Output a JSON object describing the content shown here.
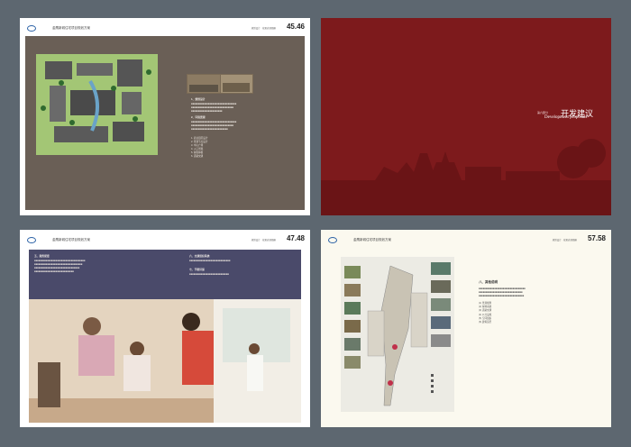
{
  "pages": [
    {
      "header": "金鹰新城住宅项目规划方案",
      "subheader": "规划设计 · 效果表现图册",
      "number": "45.46"
    },
    {
      "section_label": "第六部分",
      "title": "开发建议",
      "english": "Development proposals"
    },
    {
      "header": "金鹰新城住宅项目规划方案",
      "subheader": "规划设计 · 效果表现图册",
      "number": "47.48"
    },
    {
      "header": "金鹰新城住宅项目规划方案",
      "subheader": "规划设计 · 效果表现图册",
      "number": "57.58"
    }
  ],
  "page1": {
    "section1": "1、规划设计",
    "section2": "2、环境景观",
    "list": [
      "1. 商业街区设计",
      "2. 景观节点设计",
      "3. 中心广场",
      "4. 入口景观",
      "5. 绿化种植",
      "6. 道路交通"
    ]
  },
  "page3": {
    "left_heading": "五、服务配套",
    "right_heading1": "六、交通组织系统",
    "right_heading2": "七、节能环保"
  },
  "page4": {
    "heading": "八、其他说明",
    "items": [
      "(1) 景观规划",
      "(2) 绿地系统",
      "(3) 道路交通",
      "(4) 公共设施",
      "(5) 空间组织",
      "(6) 建筑造型"
    ]
  }
}
